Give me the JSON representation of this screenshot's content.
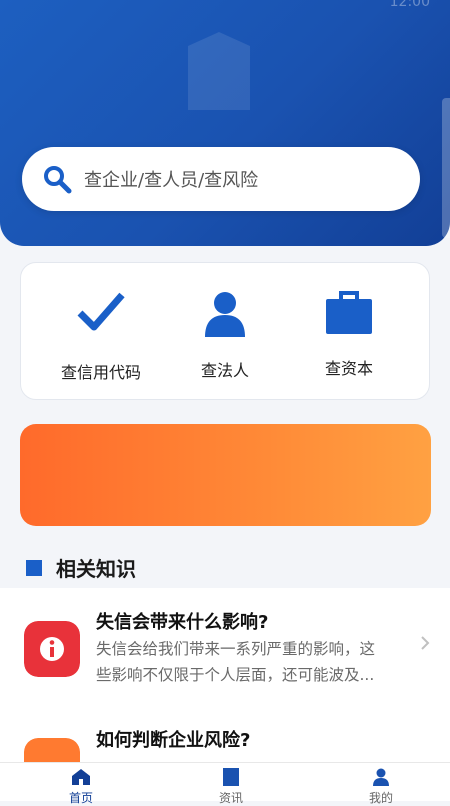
{
  "status_bar": {
    "time": "12:00"
  },
  "colors": {
    "brand_blue": "#1a5fc8",
    "accent_orange": "#ff7a30",
    "alert_red": "#e8323a"
  },
  "search": {
    "placeholder": "查企业/查人员/查风险",
    "icon": "search-icon"
  },
  "quick_actions": [
    {
      "label": "查信用代码",
      "icon": "check-icon"
    },
    {
      "label": "查法人",
      "icon": "person-icon"
    },
    {
      "label": "查资本",
      "icon": "briefcase-icon"
    }
  ],
  "section": {
    "title": "相关知识"
  },
  "articles": [
    {
      "title": "失信会带来什么影响?",
      "summary_line1": "失信会给我们带来一系列严重的影响，这",
      "summary_line2": "些影响不仅限于个人层面，还可能波及...",
      "icon": "info-icon"
    },
    {
      "title": "如何判断企业风险?",
      "icon": "warning-icon"
    }
  ],
  "tabbar": [
    {
      "label": "首页",
      "icon": "home-icon",
      "active": true
    },
    {
      "label": "资讯",
      "icon": "news-icon",
      "active": false
    },
    {
      "label": "我的",
      "icon": "profile-icon",
      "active": false
    }
  ]
}
